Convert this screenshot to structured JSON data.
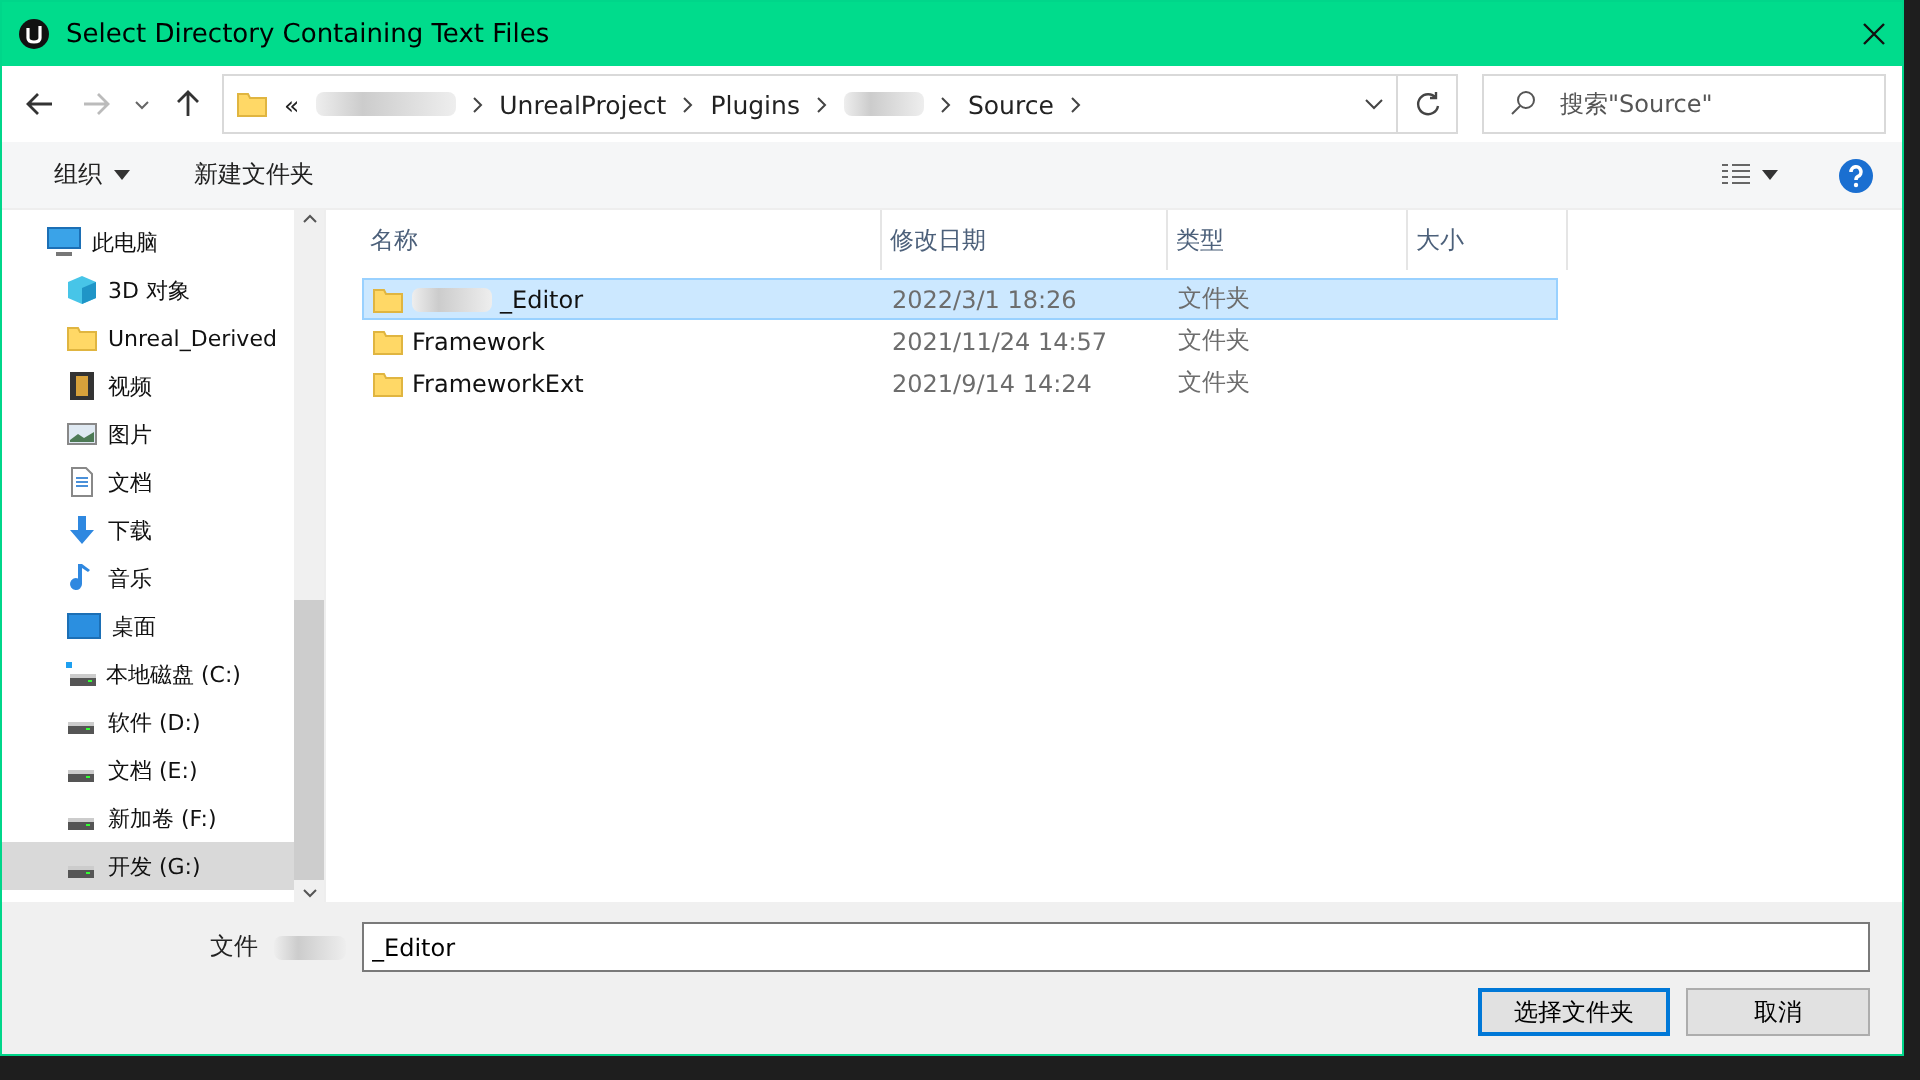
{
  "window": {
    "title": "Select Directory Containing Text Files"
  },
  "address": {
    "segments": [
      {
        "kind": "text",
        "label": "«"
      },
      {
        "kind": "blurred"
      },
      {
        "kind": "text",
        "label": "UnrealProject"
      },
      {
        "kind": "text",
        "label": "Plugins"
      },
      {
        "kind": "blurred"
      },
      {
        "kind": "text",
        "label": "Source"
      }
    ]
  },
  "search": {
    "placeholder": "搜索\"Source\""
  },
  "toolbar": {
    "organize": "组织",
    "new_folder": "新建文件夹"
  },
  "sidebar": {
    "items": [
      {
        "label": "此电脑",
        "kind": "pc",
        "selected": false,
        "children": [
          {
            "label": "3D 对象",
            "kind": "cube",
            "selected": false
          },
          {
            "label": "Unreal_Derived",
            "kind": "folder",
            "selected": false
          },
          {
            "label": "视频",
            "kind": "video",
            "selected": false
          },
          {
            "label": "图片",
            "kind": "picture",
            "selected": false
          },
          {
            "label": "文档",
            "kind": "document",
            "selected": false
          },
          {
            "label": "下载",
            "kind": "download",
            "selected": false
          },
          {
            "label": "音乐",
            "kind": "music",
            "selected": false
          },
          {
            "label": "桌面",
            "kind": "desktop",
            "selected": false
          },
          {
            "label": "本地磁盘 (C:)",
            "kind": "system-drive",
            "selected": false
          },
          {
            "label": "软件 (D:)",
            "kind": "drive",
            "selected": false
          },
          {
            "label": "文档 (E:)",
            "kind": "drive",
            "selected": false
          },
          {
            "label": "新加卷 (F:)",
            "kind": "drive",
            "selected": false
          },
          {
            "label": "开发 (G:)",
            "kind": "drive",
            "selected": true
          }
        ]
      }
    ]
  },
  "table": {
    "columns": [
      "名称",
      "修改日期",
      "类型",
      "大小"
    ],
    "rows": [
      {
        "name": "_Editor",
        "name_blurred": true,
        "modified": "2022/3/1 18:26",
        "type": "文件夹",
        "selected": true
      },
      {
        "name": "Framework",
        "name_blurred": false,
        "modified": "2021/11/24 14:57",
        "type": "文件夹",
        "selected": false
      },
      {
        "name": "FrameworkExt",
        "name_blurred": false,
        "modified": "2021/9/14 14:24",
        "type": "文件夹",
        "selected": false
      }
    ]
  },
  "footer": {
    "label": "文件",
    "value": "_Editor",
    "buttons": [
      {
        "label": "选择文件夹",
        "primary": true
      },
      {
        "label": "取消",
        "primary": false
      }
    ]
  }
}
